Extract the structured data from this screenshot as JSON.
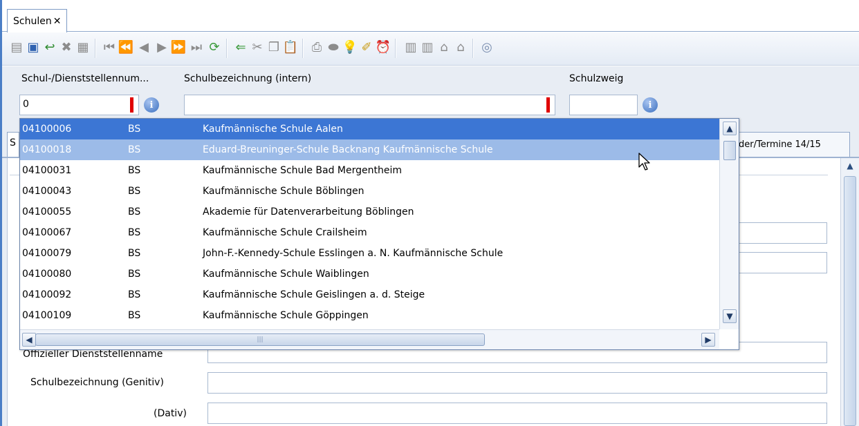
{
  "document_tab": {
    "title": "Schulen",
    "close_glyph": "✕"
  },
  "toolbar": {
    "icons": [
      "document-gray-icon",
      "save-icon",
      "undo-icon",
      "delete-icon",
      "form-icon",
      "first-record-icon",
      "page-back-icon",
      "previous-icon",
      "next-icon",
      "page-forward-icon",
      "last-record-icon",
      "refresh-icon",
      "back-arrow-icon",
      "cut-icon",
      "copy-icon",
      "paste-icon",
      "print-icon",
      "preview-icon",
      "hint-icon",
      "broom-icon",
      "alarm-icon",
      "report-icon",
      "report-list-icon",
      "export-icon",
      "import-icon",
      "help-icon"
    ]
  },
  "header_fields": {
    "number_label": "Schul-/Dienststellennum...",
    "number_value": "0",
    "name_label": "Schulbezeichnung (intern)",
    "name_value": "",
    "branch_label": "Schulzweig",
    "branch_value": ""
  },
  "subtabs": {
    "left": "S",
    "right": "der/Termine 14/15"
  },
  "form_labels": {
    "official_name": "Offizieller Dienststellenname",
    "genitive": "Schulbezeichnung (Genitiv)",
    "dative": "(Dativ)"
  },
  "dropdown": {
    "rows": [
      {
        "number": "04100006",
        "type": "BS",
        "name": "Kaufmännische Schule Aalen"
      },
      {
        "number": "04100018",
        "type": "BS",
        "name": "Eduard-Breuninger-Schule Backnang Kaufmännische Schule"
      },
      {
        "number": "04100031",
        "type": "BS",
        "name": "Kaufmännische Schule Bad Mergentheim"
      },
      {
        "number": "04100043",
        "type": "BS",
        "name": "Kaufmännische Schule Böblingen"
      },
      {
        "number": "04100055",
        "type": "BS",
        "name": "Akademie für Datenverarbeitung Böblingen"
      },
      {
        "number": "04100067",
        "type": "BS",
        "name": "Kaufmännische Schule Crailsheim"
      },
      {
        "number": "04100079",
        "type": "BS",
        "name": "John-F.-Kennedy-Schule Esslingen a. N. Kaufmännische Schule"
      },
      {
        "number": "04100080",
        "type": "BS",
        "name": "Kaufmännische Schule Waiblingen"
      },
      {
        "number": "04100092",
        "type": "BS",
        "name": "Kaufmännische Schule Geislingen a. d. Steige"
      },
      {
        "number": "04100109",
        "type": "BS",
        "name": "Kaufmännische Schule Göppingen"
      }
    ],
    "selected_index": 0,
    "hover_index": 1
  },
  "colors": {
    "selected_row": "#3c76d4",
    "hover_row": "#9cbbe8",
    "required_marker": "#e00000",
    "window_frame": "#4a7ec6"
  }
}
